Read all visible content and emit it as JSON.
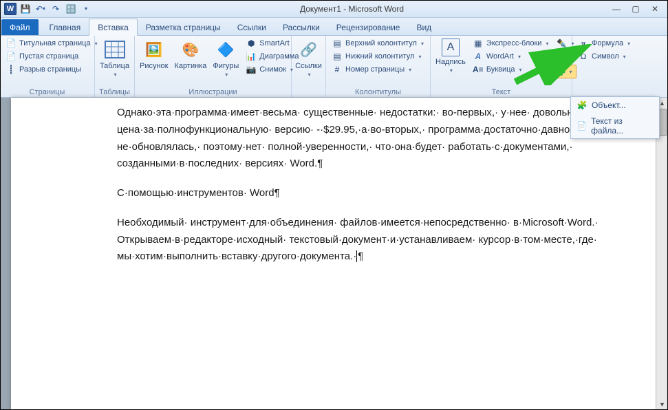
{
  "window": {
    "title": "Документ1 - Microsoft Word"
  },
  "qat": {
    "save": "💾",
    "undo": "↶",
    "redo": "↷",
    "format": "🔠"
  },
  "tabs": {
    "file": "Файл",
    "home": "Главная",
    "insert": "Вставка",
    "layout": "Разметка страницы",
    "references": "Ссылки",
    "mailings": "Рассылки",
    "review": "Рецензирование",
    "view": "Вид"
  },
  "ribbon": {
    "pages": {
      "title": "Страницы",
      "cover": "Титульная страница",
      "blank": "Пустая страница",
      "break": "Разрыв страницы"
    },
    "tables": {
      "title": "Таблицы",
      "table": "Таблица"
    },
    "illustrations": {
      "title": "Иллюстрации",
      "picture": "Рисунок",
      "clipart": "Картинка",
      "shapes": "Фигуры",
      "smartart": "SmartArt",
      "chart": "Диаграмма",
      "screenshot": "Снимок"
    },
    "links": {
      "title": "",
      "hyperlink": "Ссылки"
    },
    "headerfooter": {
      "title": "Колонтитулы",
      "header": "Верхний колонтитул",
      "footer": "Нижний колонтитул",
      "pagenum": "Номер страницы"
    },
    "text": {
      "title": "Текст",
      "textbox": "Надпись",
      "quickparts": "Экспресс-блоки",
      "wordart": "WordArt",
      "dropcap": "Буквица"
    },
    "symbols": {
      "equation": "Формула",
      "symbol": "Символ"
    }
  },
  "dropdown": {
    "object": "Объект...",
    "textfromfile": "Текст из файла..."
  },
  "document": {
    "p1": "Однако·эта·программа·имеет·весьма· существенные· недостатки:· во-первых,· у·нее· довольно· высокая· цена·за·полнофункциональную· версию· -·$29.95,·а·во-вторых,· программа·достаточно·давно· не·обновлялась,· поэтому·нет· полной·уверенности,· что·она·будет· работать·с·документами,· созданными·в·последних· версиях· Word.",
    "p2": "С·помощью·инструментов· Word",
    "p3": "Необходимый· инструмент·для·объединения· файлов·имеется·непосредственно· в·Microsoft·Word.· Открываем·в·редакторе·исходный· текстовый·документ·и·устанавливаем· курсор·в·том·месте,·где· мы·хотим·выполнить·вставку·другого·документа.·"
  }
}
